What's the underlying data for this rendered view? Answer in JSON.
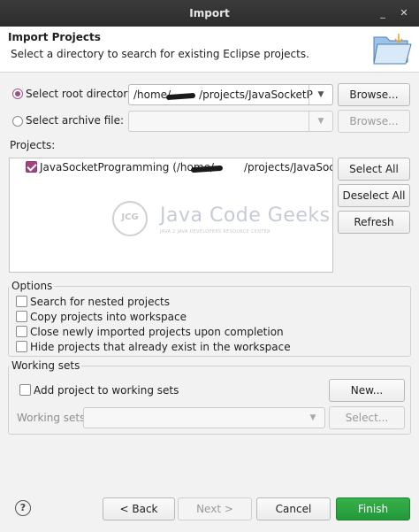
{
  "window": {
    "title": "Import",
    "minimize_glyph": "_",
    "close_glyph": "✕"
  },
  "header": {
    "title": "Import Projects",
    "description": "Select a directory to search for existing Eclipse projects."
  },
  "source": {
    "root_directory_label": "Select root directory:",
    "root_directory_value_prefix": "/home/",
    "root_directory_value_suffix": "/projects/JavaSocketP",
    "archive_file_label": "Select archive file:",
    "browse_label": "Browse...",
    "selected": "root_directory"
  },
  "projects": {
    "label": "Projects:",
    "items": [
      {
        "name_prefix": "JavaSocketProgramming (/home/",
        "name_suffix": "/projects/JavaSocketP",
        "checked": true
      }
    ],
    "select_all": "Select All",
    "deselect_all": "Deselect All",
    "refresh": "Refresh"
  },
  "watermark": {
    "brand": "Java Code Geeks",
    "badge": "JCG",
    "tagline": "JAVA 2 JAVA DEVELOPERS RESOURCE CENTER"
  },
  "options": {
    "label": "Options",
    "items": [
      {
        "label": "Search for nested projects",
        "checked": false
      },
      {
        "label": "Copy projects into workspace",
        "checked": false
      },
      {
        "label": "Close newly imported projects upon completion",
        "checked": false
      },
      {
        "label": "Hide projects that already exist in the workspace",
        "checked": false
      }
    ]
  },
  "working_sets": {
    "label": "Working sets",
    "add_label": "Add project to working sets",
    "new_label": "New...",
    "sets_label": "Working sets:",
    "select_label": "Select..."
  },
  "footer": {
    "back": "< Back",
    "next": "Next >",
    "cancel": "Cancel",
    "finish": "Finish"
  },
  "colors": {
    "accent": "#a0467f",
    "finish": "#2aa13f",
    "titlebar": "#2f2f2f"
  }
}
